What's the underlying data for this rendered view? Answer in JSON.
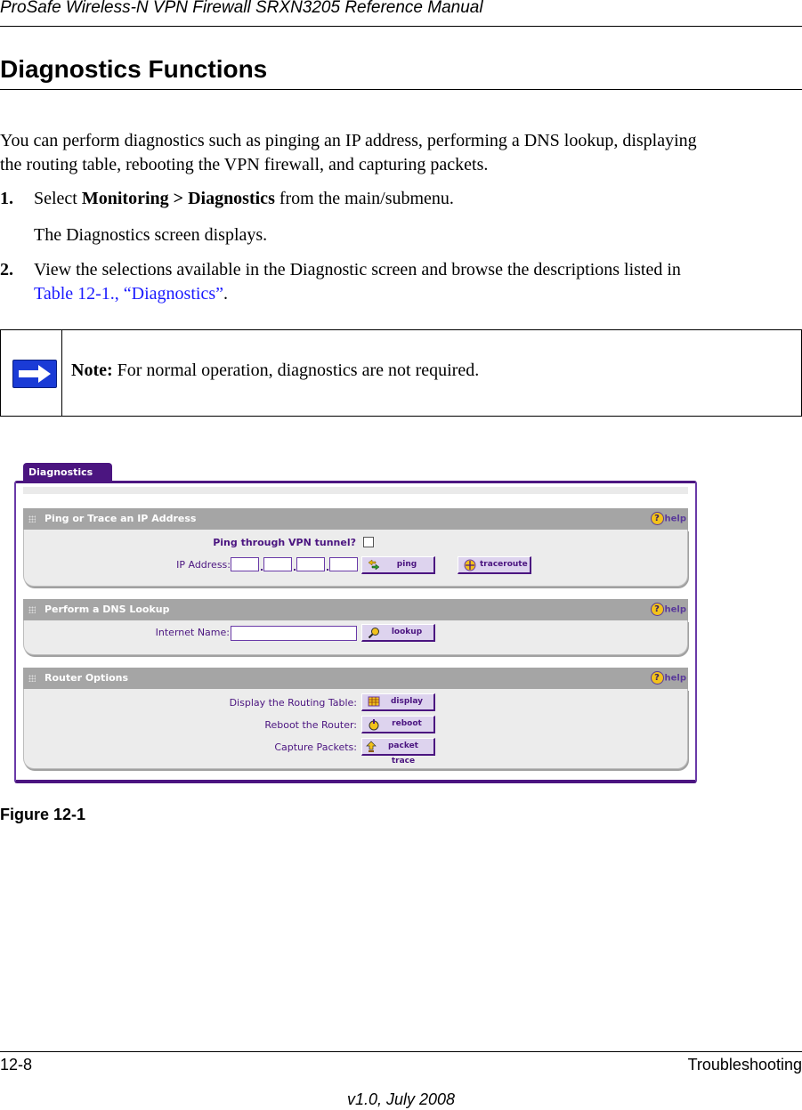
{
  "header": {
    "running_title": "ProSafe Wireless-N VPN Firewall SRXN3205 Reference Manual"
  },
  "section": {
    "title": "Diagnostics Functions"
  },
  "intro": "You can perform diagnostics such as pinging an IP address, performing a DNS lookup, displaying the routing table, rebooting the VPN firewall, and capturing packets.",
  "intro_line1": "You can perform diagnostics such as pinging an IP address, performing a DNS lookup, displaying",
  "intro_line2": "the routing table, rebooting the VPN firewall, and capturing packets.",
  "steps": [
    {
      "number": "1.",
      "pre": "Select ",
      "bold1": "Monitoring",
      "sep": " > ",
      "bold2": "Diagnostics",
      "post": " from the main/submenu.",
      "followup": "The Diagnostics screen displays."
    },
    {
      "number": "2.",
      "line1": "View the selections available in the Diagnostic screen and browse the descriptions listed in",
      "link": "Table 12-1., “Diagnostics”",
      "post": "."
    }
  ],
  "note": {
    "icon": "arrow-right-icon",
    "label": "Note:",
    "text": " For normal operation, diagnostics are not required."
  },
  "screenshot": {
    "tab": "Diagnostics",
    "help_label": "help",
    "sections": [
      {
        "title": "Ping or Trace an IP Address",
        "vpn_label": "Ping through VPN tunnel?",
        "vpn_checked": false,
        "ip_label": "IP Address:",
        "ip_octets": [
          "",
          "",
          "",
          ""
        ],
        "buttons": [
          {
            "label": "ping",
            "icon": "ping-arrows-icon"
          },
          {
            "label": "traceroute",
            "icon": "traceroute-icon"
          }
        ]
      },
      {
        "title": "Perform a DNS Lookup",
        "name_label": "Internet Name:",
        "name_value": "",
        "buttons": [
          {
            "label": "lookup",
            "icon": "magnifier-icon"
          }
        ]
      },
      {
        "title": "Router Options",
        "rows": [
          {
            "label": "Display the Routing Table:",
            "button": "display",
            "icon": "table-icon"
          },
          {
            "label": "Reboot the Router:",
            "button": "reboot",
            "icon": "reboot-icon"
          },
          {
            "label": "Capture Packets:",
            "button": "packet trace",
            "icon": "upload-arrow-icon"
          }
        ]
      }
    ]
  },
  "figure_caption": "Figure 12-1",
  "footer": {
    "page": "12-8",
    "chapter": "Troubleshooting",
    "version": "v1.0, July 2008"
  },
  "colors": {
    "accent": "#4b1580",
    "link": "#1a1aff",
    "section_header": "#a5a5a5",
    "note_icon": "#1a3bd6"
  }
}
